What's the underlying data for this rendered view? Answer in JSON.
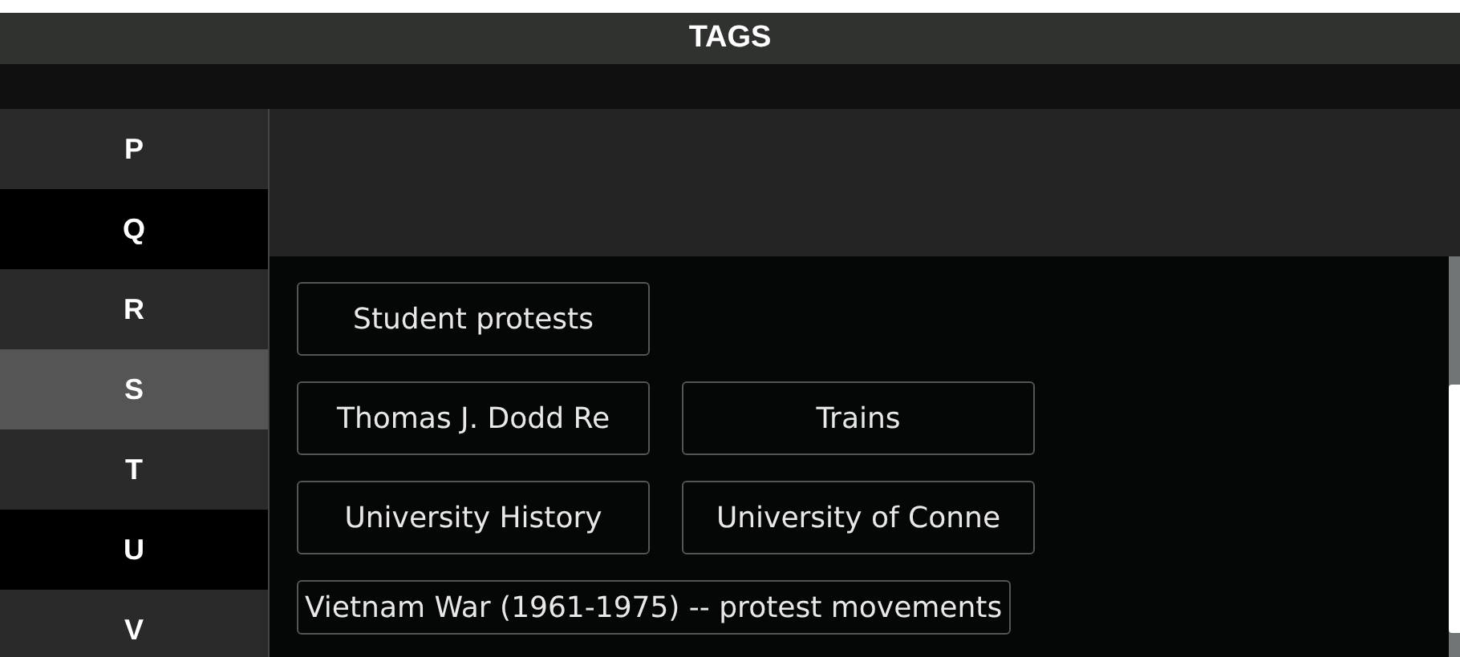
{
  "window": {
    "title": "TAGS"
  },
  "letters": [
    {
      "label": "P",
      "selected": false
    },
    {
      "label": "Q",
      "selected": false
    },
    {
      "label": "R",
      "selected": false
    },
    {
      "label": "S",
      "selected": true
    },
    {
      "label": "T",
      "selected": false
    },
    {
      "label": "U",
      "selected": false
    },
    {
      "label": "V",
      "selected": false
    }
  ],
  "tag_rows": [
    [
      "Student protests"
    ],
    [
      "Thomas J. Dodd Re",
      "Trains"
    ],
    [
      "University History",
      "University of Conne"
    ],
    [
      "Vietnam War (1961-1975) -- protest movements"
    ]
  ]
}
